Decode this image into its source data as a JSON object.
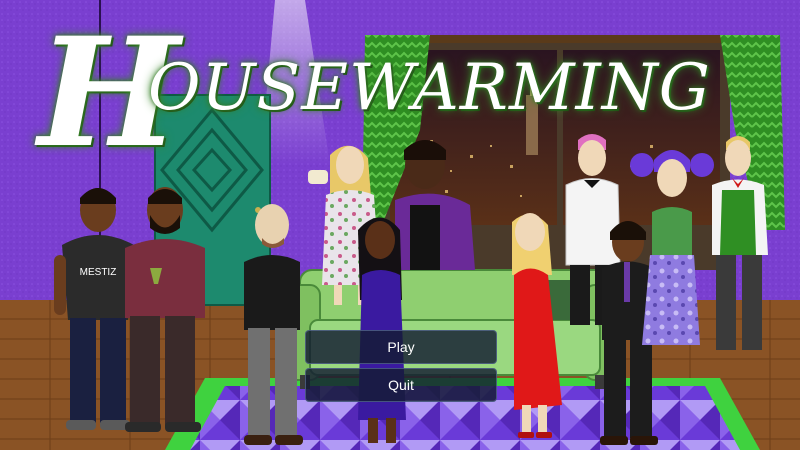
{
  "game": {
    "title_first": "H",
    "title_rest": "OUSEWARMING"
  },
  "menu": {
    "play_label": "Play",
    "quit_label": "Quit"
  },
  "scene": {
    "shirt_text": "MESTIZ",
    "colors": {
      "wall": "#7a3fd0",
      "curtain": "#2f8f23",
      "door": "#1d8a6e",
      "floor": "#8a5325",
      "rug": "#6a3ad8",
      "sofa": "#8fcf70",
      "red_dress": "#e01818",
      "button_bg": "#141c32"
    }
  }
}
